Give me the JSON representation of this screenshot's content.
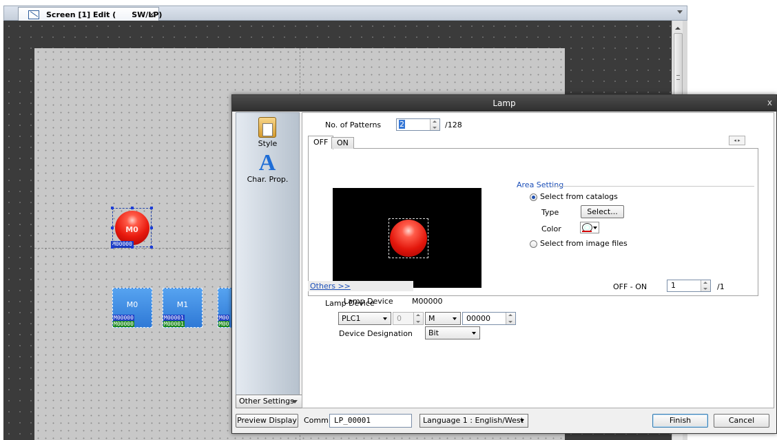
{
  "editor": {
    "tab_title": "Screen [1] Edit (      SW/LP)",
    "tab_close": "×",
    "lamp": {
      "label": "M0",
      "device": "M00000"
    },
    "switches": [
      {
        "label": "M0",
        "dev_top": "M00000",
        "dev_bottom": "M00000"
      },
      {
        "label": "M1",
        "dev_top": "M00001",
        "dev_bottom": "M00001"
      },
      {
        "label": "",
        "dev_top": "M00",
        "dev_bottom": "M00"
      }
    ]
  },
  "dialog": {
    "title": "Lamp",
    "close": "x",
    "sidebar": {
      "items": [
        {
          "label": "Style",
          "icon": "clipboard-icon"
        },
        {
          "label": "Char. Prop.",
          "icon": "letter-a-icon"
        }
      ],
      "other_settings": "Other Settings"
    },
    "patterns": {
      "label": "No. of Patterns",
      "value": "2",
      "max": "/128"
    },
    "tabs": [
      "OFF",
      "ON"
    ],
    "tab_scroll": "◂ ▸",
    "preview": {
      "lamp_device_label": "Lamp Device",
      "lamp_device_value": "M00000"
    },
    "area_setting": {
      "title": "Area Setting",
      "option_catalogs": "Select from catalogs",
      "type_label": "Type",
      "select_button": "Select...",
      "color_label": "Color",
      "option_image_files": "Select from image files",
      "selected": "catalogs"
    },
    "others_link": "Others >>",
    "off_on": {
      "label": "OFF - ON",
      "value": "1",
      "max": "/1"
    },
    "lamp_device": {
      "label": "Lamp Device",
      "plc": "PLC1",
      "station": "0",
      "type": "M",
      "address": "00000",
      "designation_label": "Device Designation",
      "designation_value": "Bit"
    },
    "bottom": {
      "preview_button": "Preview Display",
      "comm_label": "Comm",
      "comm_value": "LP_00001",
      "language": "Language 1 : English/West",
      "finish": "Finish",
      "cancel": "Cancel"
    }
  }
}
